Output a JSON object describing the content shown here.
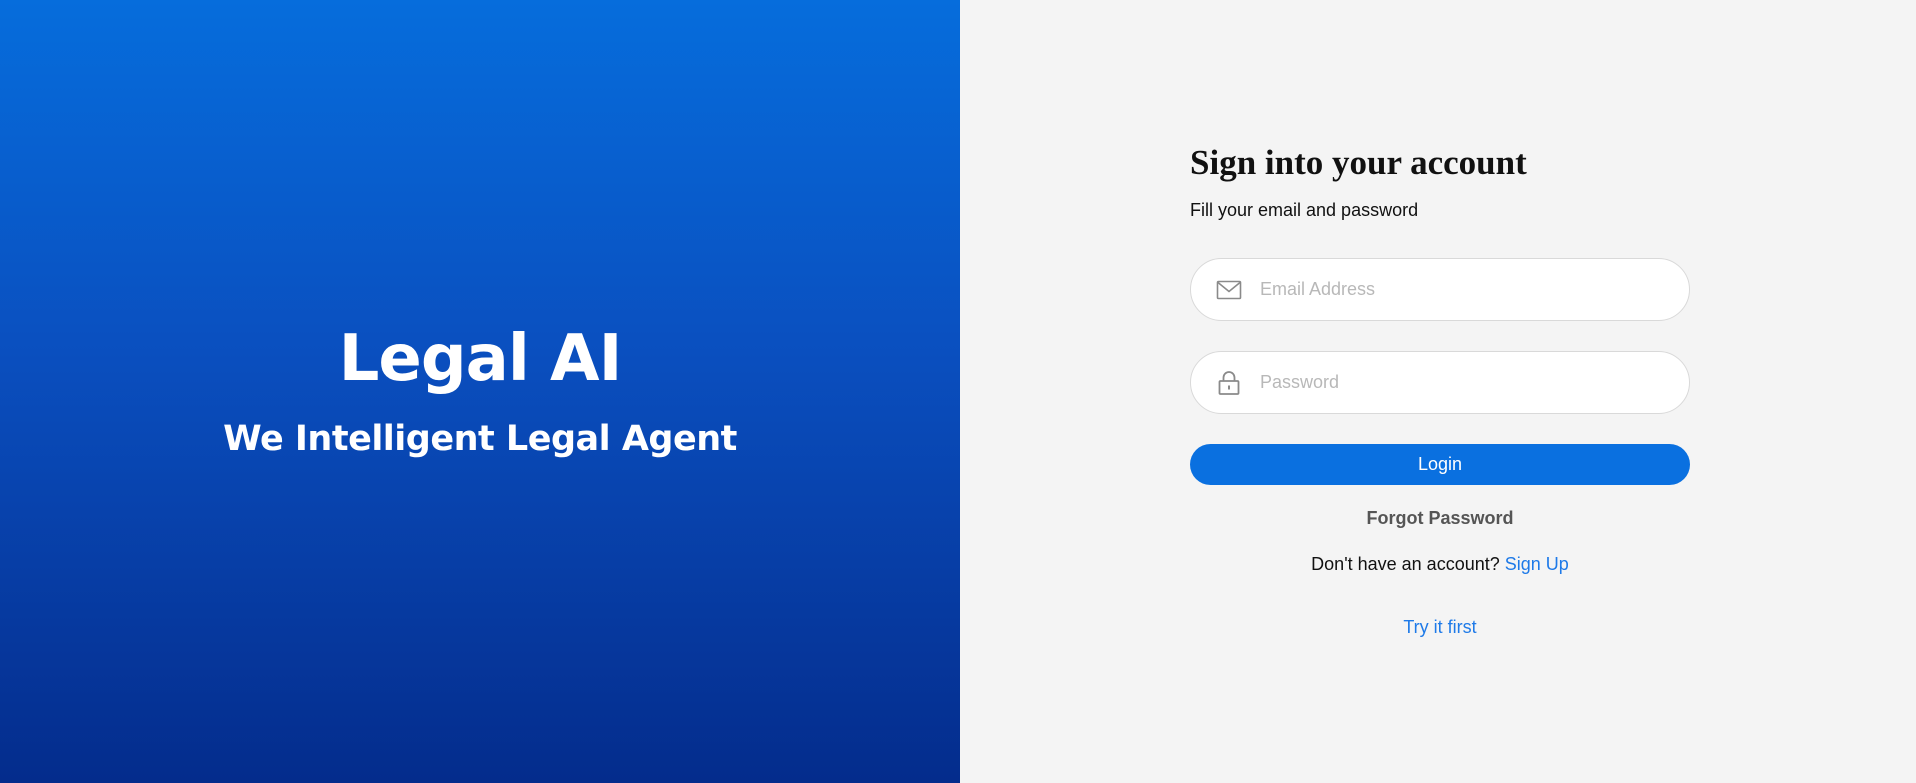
{
  "hero": {
    "title": "Legal AI",
    "subtitle": "We Intelligent Legal Agent"
  },
  "form": {
    "title": "Sign into your account",
    "subtitle": "Fill your email and password",
    "email": {
      "placeholder": "Email Address",
      "value": "",
      "icon": "mail-icon"
    },
    "password": {
      "placeholder": "Password",
      "value": "",
      "icon": "lock-icon"
    },
    "login_label": "Login",
    "forgot_label": "Forgot Password",
    "no_account_text": "Don't have an account?",
    "signup_label": "Sign Up",
    "try_label": "Try it first"
  },
  "colors": {
    "brand_blue": "#0a70e0",
    "link_blue": "#1e7ae8",
    "panel_bg": "#f4f4f4"
  }
}
